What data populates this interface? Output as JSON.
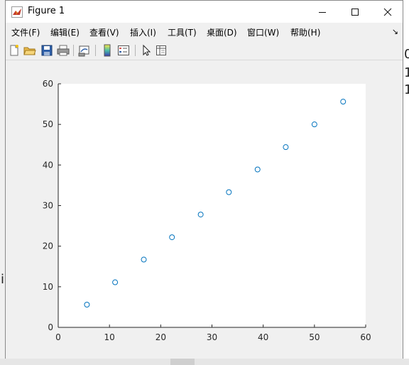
{
  "window": {
    "title": "Figure 1",
    "minimize_icon": "minimize-icon",
    "maximize_icon": "maximize-icon",
    "close_icon": "close-icon"
  },
  "menu": {
    "items": [
      {
        "label": "文件(F)"
      },
      {
        "label": "编辑(E)"
      },
      {
        "label": "查看(V)"
      },
      {
        "label": "插入(I)"
      },
      {
        "label": "工具(T)"
      },
      {
        "label": "桌面(D)"
      },
      {
        "label": "窗口(W)"
      },
      {
        "label": "帮助(H)"
      }
    ],
    "dock_arrow": "↘"
  },
  "toolbar": {
    "icons": [
      "new-figure-icon",
      "open-file-icon",
      "save-icon",
      "print-icon",
      "link-plot-icon",
      "colorbar-icon",
      "legend-icon",
      "edit-plot-pointer-icon",
      "property-inspector-icon"
    ]
  },
  "background_text": {
    "right_lines": [
      "0",
      "1",
      "1"
    ],
    "left_text": "i"
  },
  "chart_data": {
    "type": "scatter",
    "title": "",
    "xlabel": "",
    "ylabel": "",
    "xlim": [
      0,
      60
    ],
    "ylim": [
      0,
      60
    ],
    "xticks": [
      0,
      10,
      20,
      30,
      40,
      50,
      60
    ],
    "yticks": [
      0,
      10,
      20,
      30,
      40,
      50,
      60
    ],
    "grid": false,
    "marker": "circle",
    "marker_color": "#0072bd",
    "x": [
      5.6,
      11.1,
      16.7,
      22.2,
      27.8,
      33.3,
      38.9,
      44.4,
      50.0,
      55.6
    ],
    "y": [
      5.6,
      11.1,
      16.7,
      22.2,
      27.8,
      33.3,
      38.9,
      44.4,
      50.0,
      55.6
    ]
  }
}
